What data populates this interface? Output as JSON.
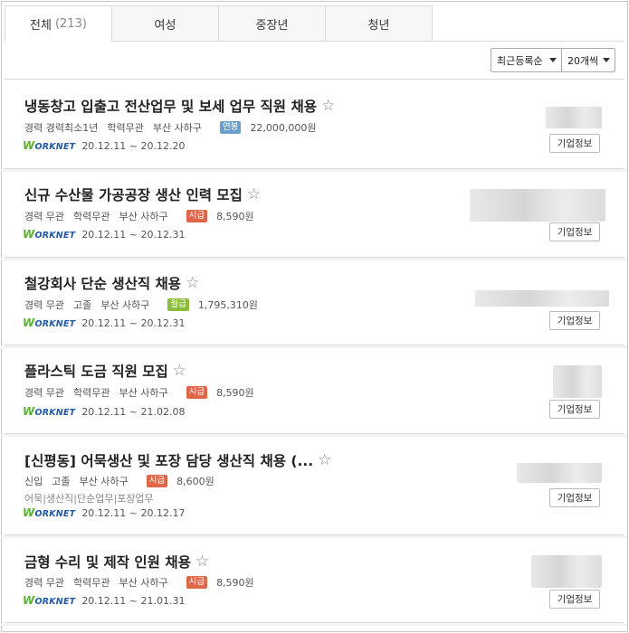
{
  "tabs": [
    {
      "label": "전체",
      "count": "(213)",
      "active": true
    },
    {
      "label": "여성"
    },
    {
      "label": "중장년"
    },
    {
      "label": "청년"
    }
  ],
  "sort": {
    "order_selected": "최근등록순",
    "per_page_selected": "20개씩"
  },
  "source_label": "WORKNET",
  "company_button_label": "기업정보",
  "colors": {
    "annual": "#6b9ec9",
    "hourly": "#e0664a",
    "monthly": "#8bbd3a"
  },
  "jobs": [
    {
      "title": "냉동창고 입출고 전산업무 및 보세 업무 직원 채용",
      "career": "경력 경력최소1년",
      "education": "학력무관",
      "location": "부산 사하구",
      "pay_type": "연봉",
      "pay": "22,000,000원",
      "period": "20.12.11 ~ 20.12.20"
    },
    {
      "title": "신규 수산물 가공공장 생산 인력 모집",
      "career": "경력 무관",
      "education": "학력무관",
      "location": "부산 사하구",
      "pay_type": "시급",
      "pay": "8,590원",
      "period": "20.12.11 ~ 20.12.31"
    },
    {
      "title": "철강회사 단순 생산직 채용",
      "career": "경력 무관",
      "education": "고졸",
      "location": "부산 사하구",
      "pay_type": "월급",
      "pay": "1,795,310원",
      "period": "20.12.11 ~ 20.12.31"
    },
    {
      "title": "플라스틱 도금 직원 모집",
      "career": "경력 무관",
      "education": "학력무관",
      "location": "부산 사하구",
      "pay_type": "시급",
      "pay": "8,590원",
      "period": "20.12.11 ~ 21.02.08"
    },
    {
      "title": "[신평동] 어묵생산 및 포장 담당 생산직 채용 (...",
      "career": "신입",
      "education": "고졸",
      "location": "부산 사하구",
      "pay_type": "시급",
      "pay": "8,600원",
      "tags": "어묵|생산직|단순업무|포장업무",
      "period": "20.12.11 ~ 20.12.17"
    },
    {
      "title": "금형 수리 및 제작 인원 채용",
      "career": "경력 무관",
      "education": "학력무관",
      "location": "부산 사하구",
      "pay_type": "시급",
      "pay": "8,590원",
      "period": "20.12.11 ~ 21.01.31"
    }
  ]
}
